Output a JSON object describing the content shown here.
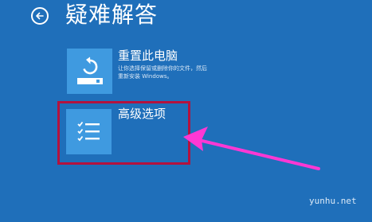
{
  "header": {
    "title": "疑难解答"
  },
  "options": [
    {
      "icon": "refresh-drive-icon",
      "title": "重置此电脑",
      "description_lines": [
        "让你选择保留或删除你的文件，然后",
        "重新安装 Windows。"
      ]
    },
    {
      "icon": "checklist-icon",
      "title": "高级选项"
    }
  ],
  "annotation": {
    "highlight_color": "#b3123e",
    "arrow_color": "#ff38d4"
  },
  "watermark": "yunhu.net",
  "colors": {
    "background": "#1f6fba",
    "tile": "#3f9ae0",
    "text": "#ffffff"
  }
}
